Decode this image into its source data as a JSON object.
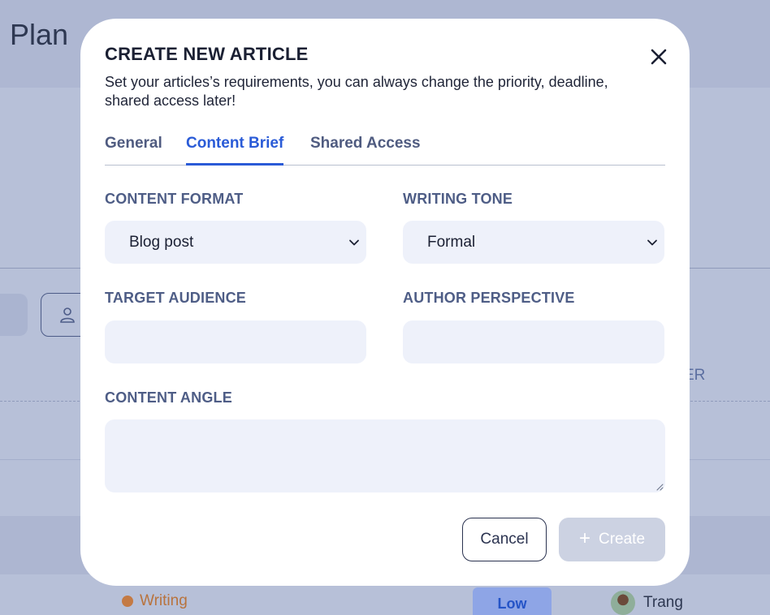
{
  "background": {
    "page_title": "Plan",
    "column_fragment": "ER",
    "row": {
      "status": "Writing",
      "priority": "Low",
      "owner": "Trang"
    }
  },
  "modal": {
    "title": "CREATE NEW ARTICLE",
    "subtitle": "Set your articles’s requirements, you can always change the priority, deadline, shared access later!",
    "tabs": [
      {
        "label": "General",
        "active": false
      },
      {
        "label": "Content Brief",
        "active": true
      },
      {
        "label": "Shared Access",
        "active": false
      }
    ],
    "fields": {
      "content_format": {
        "label": "CONTENT FORMAT",
        "value": "Blog post"
      },
      "writing_tone": {
        "label": "WRITING TONE",
        "value": "Formal"
      },
      "target_audience": {
        "label": "TARGET AUDIENCE",
        "value": ""
      },
      "author_perspective": {
        "label": "AUTHOR PERSPECTIVE",
        "value": ""
      },
      "content_angle": {
        "label": "CONTENT ANGLE",
        "value": ""
      }
    },
    "buttons": {
      "cancel": "Cancel",
      "create": "Create",
      "create_icon": "+"
    }
  },
  "colors": {
    "accent": "#2a5bd7",
    "overlay": "#b7c0d8",
    "field_bg": "#eef1fa",
    "disabled_button": "#ccd2e2",
    "status_writing": "#c47a44"
  },
  "icons": [
    "close-icon",
    "chevron-down-icon",
    "user-icon",
    "plus-icon",
    "resize-grip-icon",
    "avatar"
  ]
}
